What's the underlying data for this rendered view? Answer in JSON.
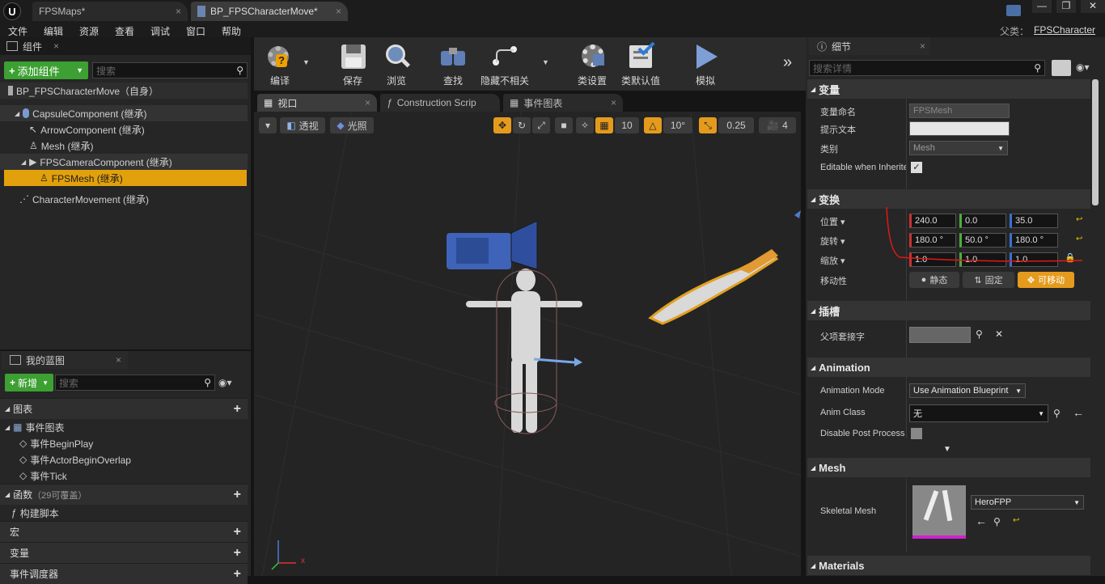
{
  "tabs": [
    {
      "label": "FPSMaps*"
    },
    {
      "label": "BP_FPSCharacterMove*"
    }
  ],
  "menu": [
    "文件",
    "编辑",
    "资源",
    "查看",
    "调试",
    "窗口",
    "帮助"
  ],
  "parent": {
    "label": "父类：",
    "value": "FPSCharacter"
  },
  "components": {
    "title": "组件",
    "add_button": "添加组件",
    "search_placeholder": "搜索",
    "root": "BP_FPSCharacterMove（自身）",
    "items": [
      "CapsuleComponent (继承)",
      "ArrowComponent (继承)",
      "Mesh (继承)",
      "FPSCameraComponent (继承)",
      "FPSMesh (继承)",
      "CharacterMovement (继承)"
    ]
  },
  "myblueprint": {
    "title": "我的蓝图",
    "add_button": "新增",
    "search_placeholder": "搜索",
    "graphs_label": "图表",
    "event_graph": "事件图表",
    "events": [
      "事件BeginPlay",
      "事件ActorBeginOverlap",
      "事件Tick"
    ],
    "functions_label": "函数",
    "functions_note": "（29可覆盖）",
    "construct": "构建脚本",
    "macros": "宏",
    "variables": "变量",
    "dispatchers": "事件调度器"
  },
  "toolbar": [
    "编译",
    "保存",
    "浏览",
    "查找",
    "隐藏不相关",
    "类设置",
    "类默认值",
    "模拟"
  ],
  "editor_tabs": [
    "视口",
    "Construction Scrip",
    "事件图表"
  ],
  "viewport": {
    "perspective": "透视",
    "lit": "光照",
    "grid_snap": "10",
    "rot_snap": "10°",
    "scale_snap": "0.25",
    "cam_speed": "4",
    "axis_x": "x"
  },
  "details": {
    "title": "细节",
    "search_placeholder": "搜索详情",
    "variable": {
      "header": "变量",
      "name_label": "变量命名",
      "name_value": "FPSMesh",
      "tooltip_label": "提示文本",
      "category_label": "类别",
      "category_value": "Mesh",
      "editable_label": "Editable when Inherite"
    },
    "transform": {
      "header": "变换",
      "location_label": "位置",
      "location": [
        "240.0",
        "0.0",
        "35.0"
      ],
      "rotation_label": "旋转",
      "rotation": [
        "180.0 °",
        "50.0 °",
        "180.0 °"
      ],
      "scale_label": "缩放",
      "scale": [
        "1.0",
        "1.0",
        "1.0"
      ],
      "mobility_label": "移动性",
      "mobility": [
        "静态",
        "固定",
        "可移动"
      ]
    },
    "sockets": {
      "header": "插槽",
      "parent_socket": "父项套接字"
    },
    "animation": {
      "header": "Animation",
      "mode_label": "Animation Mode",
      "mode_value": "Use Animation Blueprint",
      "class_label": "Anim Class",
      "class_value": "无",
      "post_label": "Disable Post Process"
    },
    "mesh": {
      "header": "Mesh",
      "label": "Skeletal Mesh",
      "value": "HeroFPP"
    },
    "materials": {
      "header": "Materials"
    }
  }
}
